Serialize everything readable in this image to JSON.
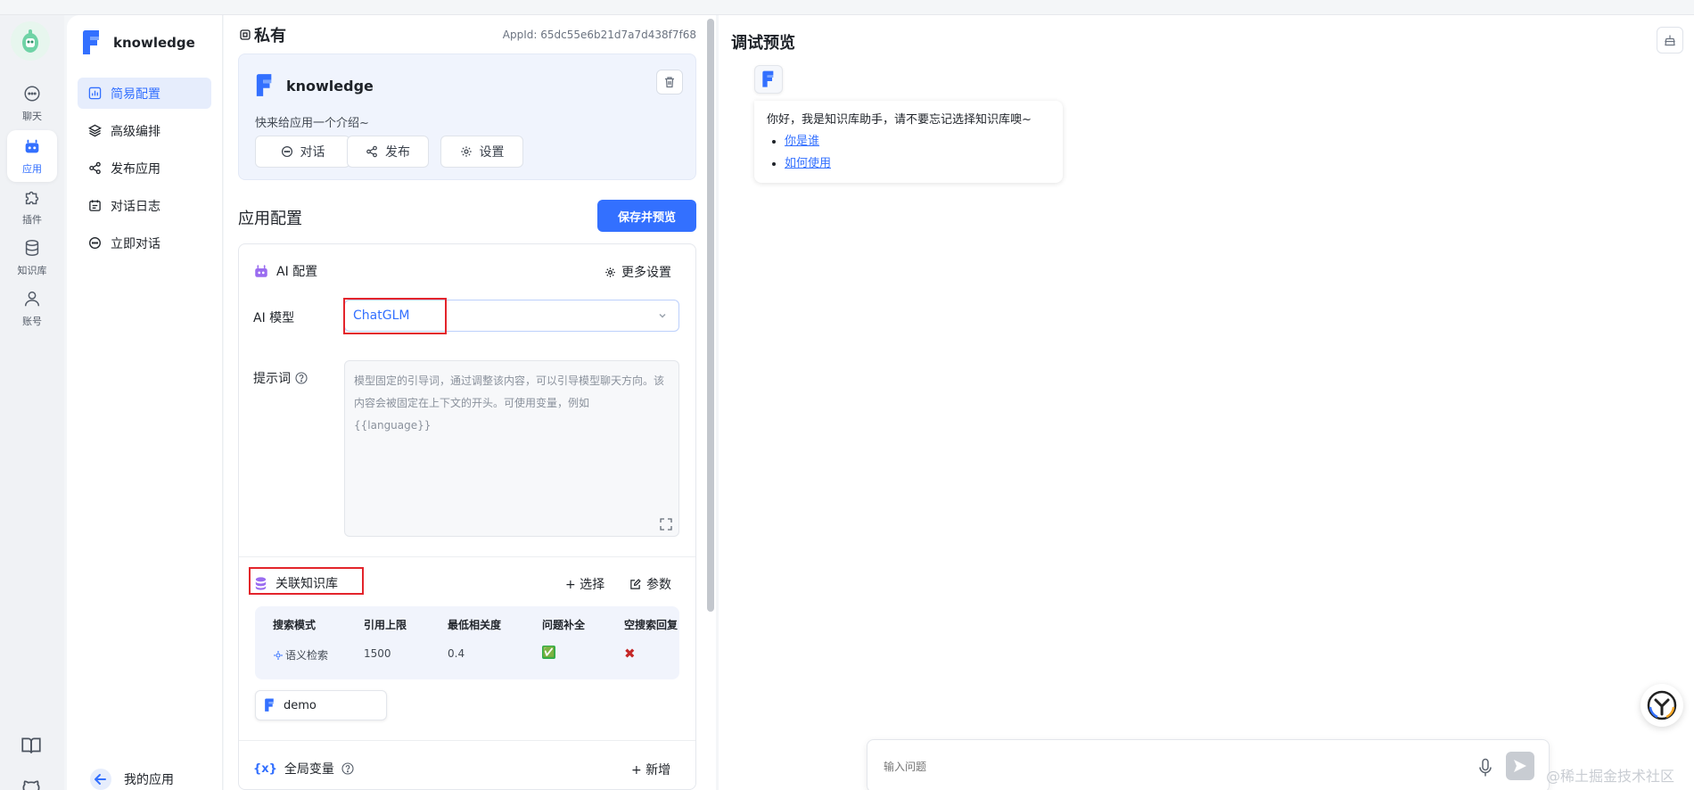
{
  "rail": {
    "items": [
      {
        "label": "聊天",
        "icon": "chat-icon"
      },
      {
        "label": "应用",
        "icon": "robot-icon"
      },
      {
        "label": "插件",
        "icon": "puzzle-icon"
      },
      {
        "label": "知识库",
        "icon": "database-icon"
      },
      {
        "label": "账号",
        "icon": "user-icon"
      }
    ],
    "active_index": 1,
    "bottom_icons": [
      "book-icon",
      "github-icon"
    ]
  },
  "appnav": {
    "app_name": "knowledge",
    "items": [
      {
        "label": "简易配置",
        "icon": "chart-icon"
      },
      {
        "label": "高级编排",
        "icon": "layers-icon"
      },
      {
        "label": "发布应用",
        "icon": "share-icon"
      },
      {
        "label": "对话日志",
        "icon": "calendar-icon"
      },
      {
        "label": "立即对话",
        "icon": "chat-icon"
      }
    ],
    "active_index": 0,
    "back_label": "我的应用"
  },
  "config": {
    "visibility": "私有",
    "app_id": "AppId: 65dc55e6b21d7a7d438f7f68",
    "card": {
      "name": "knowledge",
      "intro": "快来给应用一个介绍~",
      "buttons": {
        "chat": "对话",
        "publish": "发布",
        "settings": "设置"
      }
    },
    "section_title": "应用配置",
    "save_label": "保存并预览",
    "ai": {
      "header": "AI 配置",
      "more_settings": "更多设置",
      "model_label": "AI 模型",
      "model_value": "ChatGLM",
      "prompt_label": "提示词",
      "prompt_placeholder": "模型固定的引导词，通过调整该内容，可以引导模型聊天方向。该内容会被固定在上下文的开头。可使用变量，例如 {{language}}"
    },
    "kb": {
      "header": "关联知识库",
      "select_label": "+ 选择",
      "params_label": "参数",
      "columns": [
        "搜索模式",
        "引用上限",
        "最低相关度",
        "问题补全",
        "空搜索回复"
      ],
      "row": {
        "mode": "语义检索",
        "limit": "1500",
        "similarity": "0.4",
        "completion": "✅",
        "empty_reply": "✖"
      },
      "chip": "demo"
    },
    "vars": {
      "header": "全局变量",
      "add_label": "+ 新增"
    }
  },
  "preview": {
    "title": "调试预览",
    "greeting": "你好，我是知识库助手，请不要忘记选择知识库噢~",
    "links": [
      "你是谁",
      "如何使用"
    ],
    "input_placeholder": "输入问题"
  },
  "watermark": "@稀土掘金技术社区",
  "colors": {
    "accent": "#3370ff",
    "highlight": "#e3242b",
    "ai_icon": "#9a6cf0"
  }
}
